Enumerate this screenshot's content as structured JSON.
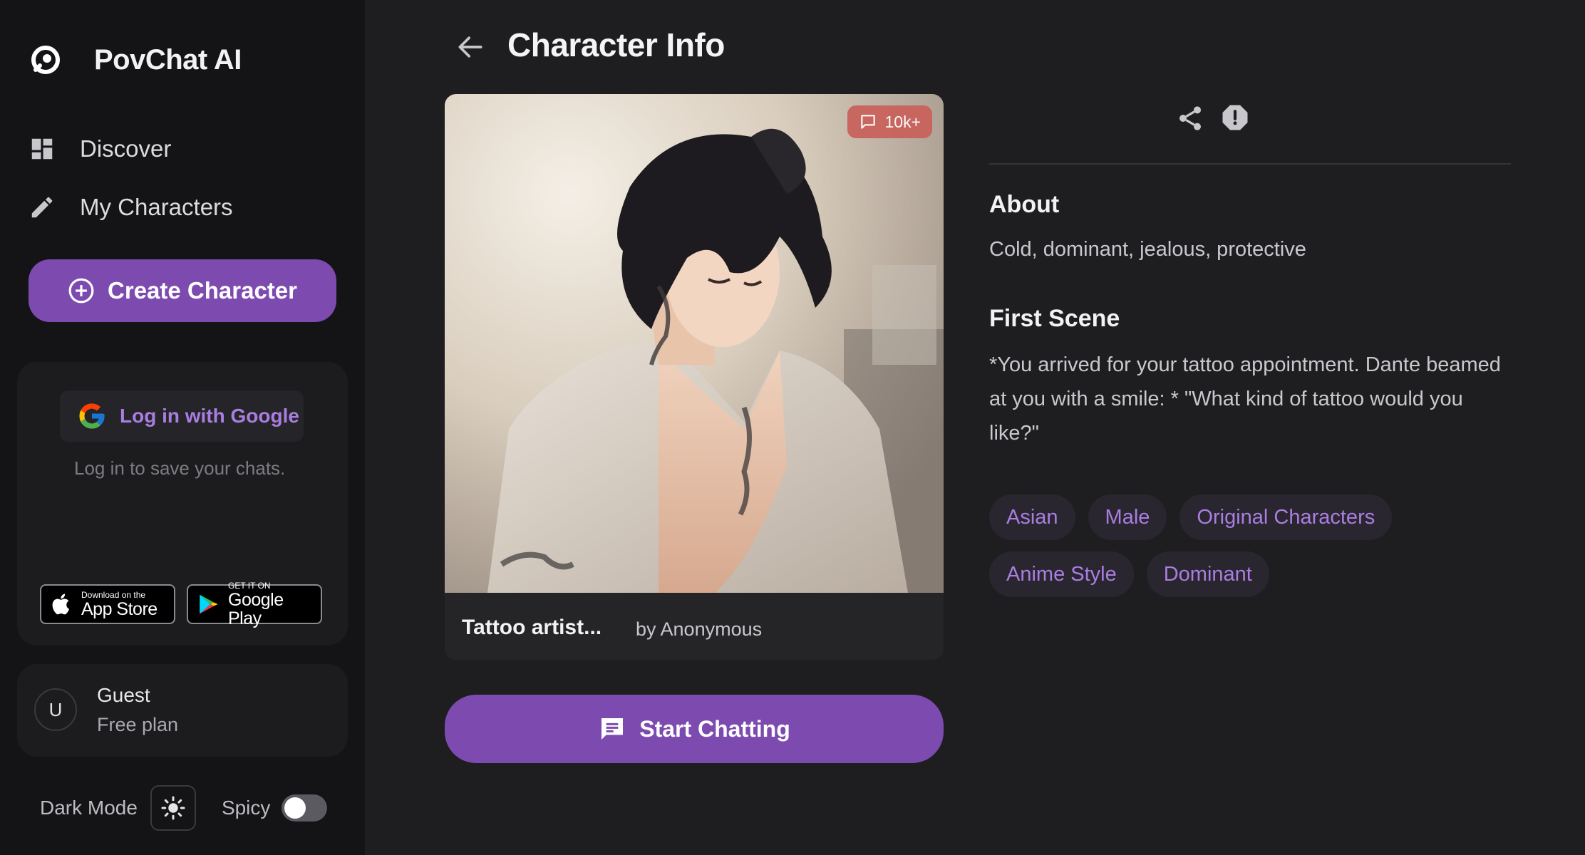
{
  "brand": {
    "name": "PovChat AI"
  },
  "nav": {
    "discover": "Discover",
    "my_characters": "My Characters"
  },
  "create_button": "Create Character",
  "login": {
    "google_label": "Log in with Google",
    "hint": "Log in to save your chats.",
    "app_store_small": "Download on the",
    "app_store_big": "App Store",
    "google_play_small": "GET IT ON",
    "google_play_big": "Google Play"
  },
  "user": {
    "avatar_initial": "U",
    "name": "Guest",
    "plan": "Free plan"
  },
  "settings": {
    "dark_mode_label": "Dark Mode",
    "spicy_label": "Spicy",
    "spicy_on": false
  },
  "page": {
    "title": "Character Info"
  },
  "character": {
    "chat_count": "10k+",
    "name": "Tattoo artist...",
    "author": "by Anonymous",
    "about_heading": "About",
    "about": "Cold, dominant, jealous, protective",
    "first_scene_heading": "First Scene",
    "first_scene": "*You arrived for your tattoo appointment. Dante beamed at you with a smile: * \"What kind of tattoo would you like?\"",
    "tags": [
      "Asian",
      "Male",
      "Original Characters",
      "Anime Style",
      "Dominant"
    ]
  },
  "start_button": "Start Chatting",
  "colors": {
    "accent": "#7d4bb0",
    "tag_text": "#a97ee0",
    "badge": "#c9605a"
  }
}
